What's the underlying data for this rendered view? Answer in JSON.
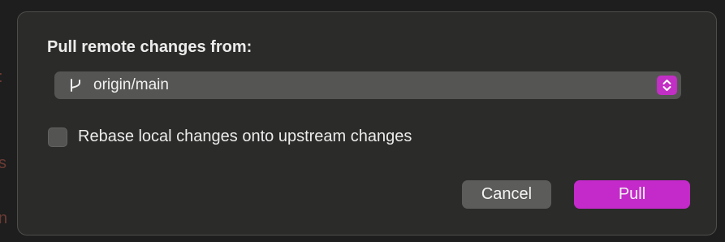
{
  "dialog": {
    "title": "Pull remote changes from:",
    "branch_select": {
      "value": "origin/main",
      "icon": "git-branch-icon"
    },
    "rebase_option": {
      "label": "Rebase local changes onto upstream changes",
      "checked": false
    },
    "buttons": {
      "cancel_label": "Cancel",
      "pull_label": "Pull"
    }
  },
  "colors": {
    "accent": "#c42ac9",
    "dialog_background": "#2b2b29",
    "select_background": "#555553",
    "cancel_background": "#5c5c5a"
  }
}
